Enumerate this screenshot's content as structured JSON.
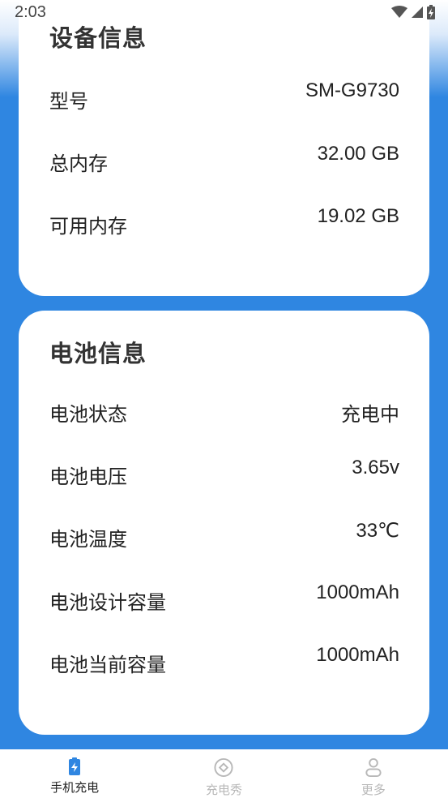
{
  "status_bar": {
    "time": "2:03",
    "icons": [
      "wifi-icon",
      "signal-icon",
      "battery-charging-icon"
    ]
  },
  "device_info": {
    "title": "设备信息",
    "rows": [
      {
        "label": "型号",
        "value": "SM-G9730"
      },
      {
        "label": "总内存",
        "value": "32.00 GB"
      },
      {
        "label": "可用内存",
        "value": "19.02 GB"
      }
    ]
  },
  "battery_info": {
    "title": "电池信息",
    "rows": [
      {
        "label": "电池状态",
        "value": "充电中"
      },
      {
        "label": "电池电压",
        "value": "3.65v"
      },
      {
        "label": "电池温度",
        "value": "33℃"
      },
      {
        "label": "电池设计容量",
        "value": "1000mAh"
      },
      {
        "label": "电池当前容量",
        "value": "1000mAh"
      }
    ]
  },
  "tabs": [
    {
      "label": "手机充电",
      "icon": "battery-bolt-icon",
      "active": true
    },
    {
      "label": "充电秀",
      "icon": "diamond-circle-icon",
      "active": false
    },
    {
      "label": "更多",
      "icon": "person-icon",
      "active": false
    }
  ],
  "colors": {
    "background_blue": "#2f86e1",
    "card": "#ffffff",
    "active_icon": "#2f86e1",
    "inactive_tab": "#b8b8b8"
  }
}
